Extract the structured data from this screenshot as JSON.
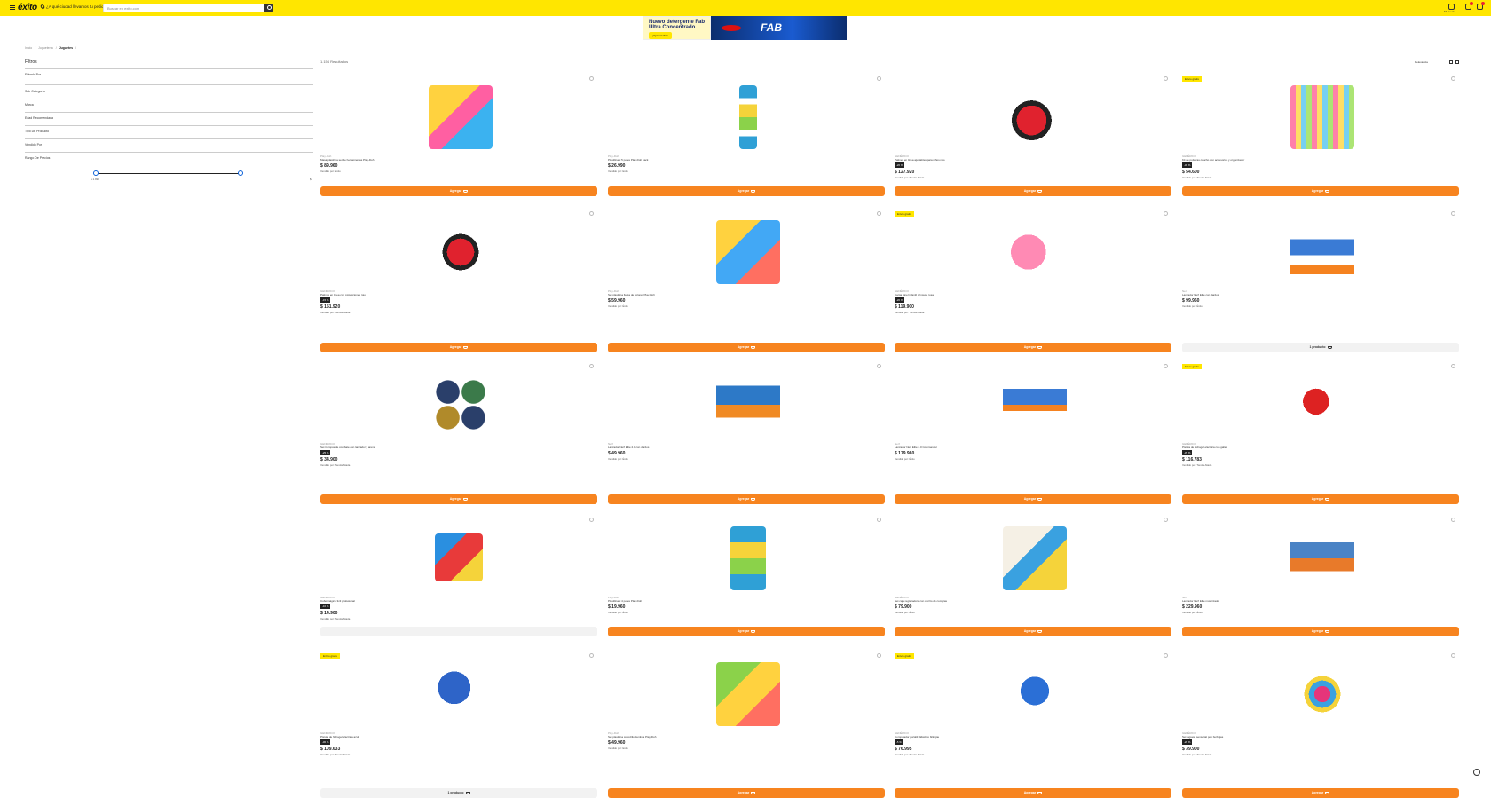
{
  "header": {
    "logo": "éxito",
    "location_prompt": "¿A qué ciudad llevamos tu pedido?",
    "search_placeholder": "Buscar en exito.com",
    "account_label": "Mi cuenta"
  },
  "banner": {
    "headline": "Nuevo detergente Fab Ultra Concentrado",
    "cta": "¡Aprovecha!",
    "brand": "FAB"
  },
  "breadcrumb": [
    "Inicio",
    "Juguetería",
    "Juguetes"
  ],
  "filters": {
    "title": "Filtros",
    "items": [
      "Filtrado Por",
      "Sub Categoría",
      "Marca",
      "Edad Recomendada",
      "Tipo De Producto",
      "Vendido Por",
      "Rango De Precios"
    ],
    "price_min": "$ 1.990",
    "price_max": "$"
  },
  "results_label": "1.154 Resultados",
  "sort_label": "Relevancia",
  "view_label": "Vista",
  "products": [
    {
      "tag": "",
      "brand": "Play-Doh",
      "title": "Masa plastilina set de herramientas Play-Doh",
      "pct": "",
      "price": "$ 89.960",
      "ship": "Vendido por: Éxito",
      "btn": "Agregar"
    },
    {
      "tag": "",
      "brand": "Play-Doh",
      "title": "Plastilina x 5 potes Play-Doh pack",
      "pct": "",
      "price": "$ 26.990",
      "ship": "Vendido por: Éxito",
      "btn": "Agregar"
    },
    {
      "tag": "",
      "brand": "GENÉRICO",
      "title": "Patines en línea ajustables para niños rojo",
      "pct": "-20 %",
      "price": "$ 127.920",
      "ship": "Vendido por: Tienda Aliada",
      "btn": "Agregar"
    },
    {
      "tag": "Envío gratis",
      "brand": "GENÉRICO",
      "title": "Kit de pulseras caucho con accesorios y organizador",
      "pct": "-30 %",
      "price": "$ 54.600",
      "ship": "Vendido por: Tienda Aliada",
      "btn": "Agregar"
    },
    {
      "tag": "",
      "brand": "GENÉRICO",
      "title": "Patines en línea con protecciones rojo",
      "pct": "-15 %",
      "price": "$ 151.920",
      "ship": "Vendido por: Tienda Aliada",
      "btn": "Agregar"
    },
    {
      "tag": "",
      "brand": "Play-Doh",
      "title": "Set plastilina fiesta de colores Play-Doh",
      "pct": "",
      "price": "$ 59.960",
      "ship": "Vendido por: Éxito",
      "btn": "Agregar"
    },
    {
      "tag": "Envío gratis",
      "brand": "GENÉRICO",
      "title": "Carpa túnel infantil princesa rosa",
      "pct": "-20 %",
      "price": "$ 119.900",
      "ship": "Vendido por: Tienda Aliada",
      "btn": "Agregar"
    },
    {
      "tag": "",
      "brand": "Nerf",
      "title": "Lanzador Nerf Elite con dardos",
      "pct": "",
      "price": "$ 99.960",
      "ship": "Vendido por: Éxito",
      "btn": "1 producto"
    },
    {
      "tag": "",
      "brand": "GENÉRICO",
      "title": "Set trompos de combate con lanzador y arena",
      "pct": "-25 %",
      "price": "$ 34.900",
      "ship": "Vendido por: Tienda Aliada",
      "btn": "Agregar"
    },
    {
      "tag": "",
      "brand": "Nerf",
      "title": "Lanzador Nerf Elite 2.0 con dardos",
      "pct": "",
      "price": "$ 49.960",
      "ship": "Vendido por: Éxito",
      "btn": "Agregar"
    },
    {
      "tag": "",
      "brand": "Nerf",
      "title": "Lanzador Nerf Elite 2.0 Commander",
      "pct": "",
      "price": "$ 179.960",
      "ship": "Vendido por: Éxito",
      "btn": "Agregar"
    },
    {
      "tag": "Envío gratis",
      "brand": "GENÉRICO",
      "title": "Pistola de hidrogel eléctrica con gafas",
      "pct": "-35 %",
      "price": "$ 116.783",
      "ship": "Vendido por: Tienda Aliada",
      "btn": "Agregar"
    },
    {
      "tag": "",
      "brand": "GENÉRICO",
      "title": "Cubo mágico 3x3 profesional",
      "pct": "-10 %",
      "price": "$ 14.900",
      "ship": "Vendido por: Tienda Aliada",
      "btn": ""
    },
    {
      "tag": "",
      "brand": "Play-Doh",
      "title": "Plastilina x 4 potes Play-Doh",
      "pct": "",
      "price": "$ 19.960",
      "ship": "Vendido por: Éxito",
      "btn": "Agregar"
    },
    {
      "tag": "",
      "brand": "GENÉRICO",
      "title": "Set caja registradora con carrito de compras",
      "pct": "",
      "price": "$ 79.900",
      "ship": "Vendido por: Éxito",
      "btn": "Agregar"
    },
    {
      "tag": "",
      "brand": "Nerf",
      "title": "Lanzador Nerf Elite motorizado",
      "pct": "",
      "price": "$ 229.960",
      "ship": "Vendido por: Éxito",
      "btn": "Agregar"
    },
    {
      "tag": "Envío gratis",
      "brand": "GENÉRICO",
      "title": "Pistola de hidrogel eléctrica azul",
      "pct": "-30 %",
      "price": "$ 109.633",
      "ship": "Vendido por: Tienda Aliada",
      "btn": "1 producto"
    },
    {
      "tag": "",
      "brand": "Play-Doh",
      "title": "Set plastilina cocodrilo dentista Play-Doh",
      "pct": "",
      "price": "$ 49.960",
      "ship": "Vendido por: Éxito",
      "btn": "Agregar"
    },
    {
      "tag": "Envío gratis",
      "brand": "GENÉRICO",
      "title": "Computador portátil didáctico bilingüe",
      "pct": "-5 %",
      "price": "$ 76.995",
      "ship": "Vendido por: Tienda Aliada",
      "btn": "Agregar"
    },
    {
      "tag": "",
      "brand": "GENÉRICO",
      "title": "Set juguete sensorial pop burbujas",
      "pct": "-20 %",
      "price": "$ 39.900",
      "ship": "Vendido por: Tienda Aliada",
      "btn": "Agregar"
    }
  ]
}
